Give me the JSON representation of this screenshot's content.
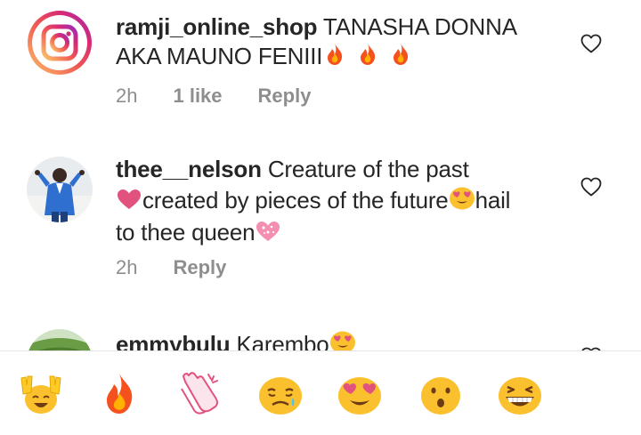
{
  "comments": [
    {
      "username": "ramji_online_shop",
      "text": "TANASHA DONNA AKA MAUNO FENIII",
      "time": "2h",
      "likes": "1 like",
      "reply": "Reply"
    },
    {
      "username": "thee__nelson",
      "text_1": "Creature of the past",
      "text_2": "created by pieces of the future",
      "text_3": "hail",
      "text_4": "to thee queen",
      "time": "2h",
      "reply": "Reply"
    },
    {
      "username": "emmybulu",
      "text": "Karembo"
    }
  ],
  "emoji_bar": {
    "items": [
      "raising-hands",
      "fire",
      "clapping-hands",
      "crying-face",
      "heart-eyes-face",
      "hushed-face",
      "grinning-squinting-face"
    ]
  },
  "colors": {
    "text": "#262626",
    "meta": "#8e8e8e",
    "heart_pink": "#e2527f",
    "fire": "#f4511e",
    "emoji_yellow": "#fbc02d"
  }
}
